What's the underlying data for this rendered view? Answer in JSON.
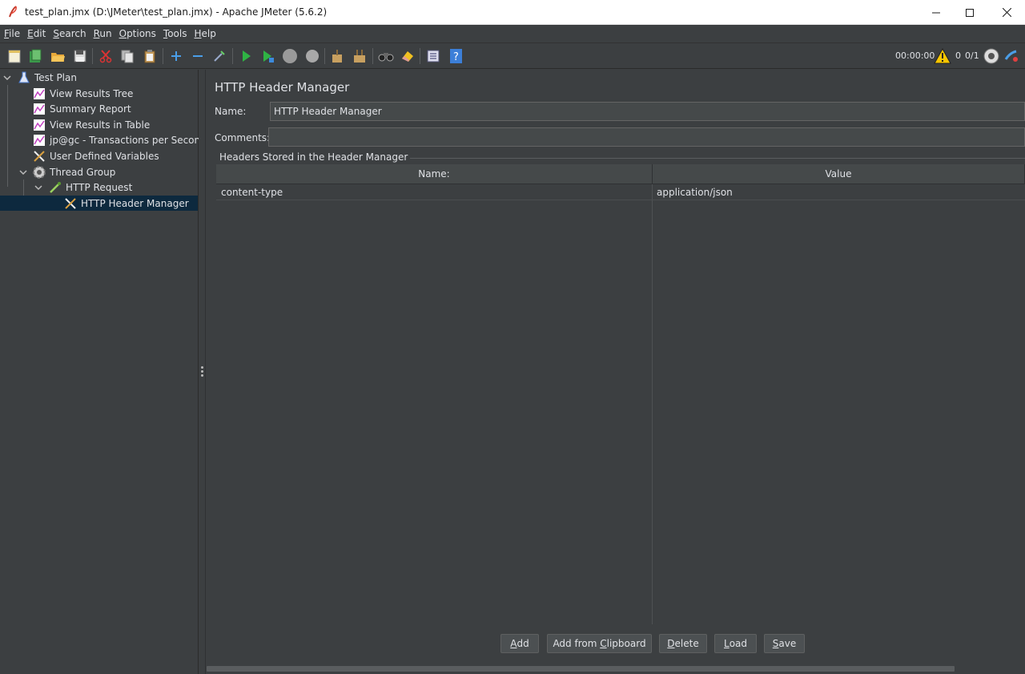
{
  "window": {
    "title": "test_plan.jmx (D:\\JMeter\\test_plan.jmx) - Apache JMeter (5.6.2)"
  },
  "menu": [
    {
      "mnemonic": "F",
      "rest": "ile"
    },
    {
      "mnemonic": "E",
      "rest": "dit"
    },
    {
      "mnemonic": "S",
      "rest": "earch"
    },
    {
      "mnemonic": "R",
      "rest": "un"
    },
    {
      "mnemonic": "O",
      "rest": "ptions"
    },
    {
      "mnemonic": "T",
      "rest": "ools"
    },
    {
      "mnemonic": "H",
      "rest": "elp"
    }
  ],
  "toolbar": {
    "elapsed_time": "00:00:00",
    "warning_count": "0",
    "active_threads": "0/1"
  },
  "tree": [
    {
      "label": "Test Plan",
      "icon": "flask-icon"
    },
    {
      "label": "View Results Tree",
      "icon": "graph-icon"
    },
    {
      "label": "Summary Report",
      "icon": "graph-icon"
    },
    {
      "label": "View Results in Table",
      "icon": "graph-icon"
    },
    {
      "label": "jp@gc - Transactions per Second",
      "icon": "graph-icon"
    },
    {
      "label": "User Defined Variables",
      "icon": "wrench-icon"
    },
    {
      "label": "Thread Group",
      "icon": "gear-icon"
    },
    {
      "label": "HTTP Request",
      "icon": "pipette-icon"
    },
    {
      "label": "HTTP Header Manager",
      "icon": "wrench-icon"
    }
  ],
  "panel": {
    "title": "HTTP Header Manager",
    "name_label": "Name:",
    "name_value": "HTTP Header Manager",
    "comments_label": "Comments:",
    "comments_value": "",
    "group_title": "Headers Stored in the Header Manager",
    "columns": [
      "Name:",
      "Value"
    ],
    "rows": [
      {
        "name": "content-type",
        "value": "application/json"
      }
    ]
  },
  "buttons": [
    {
      "mnemonic": "A",
      "rest": "dd",
      "pre": ""
    },
    {
      "pre": "Add from ",
      "mnemonic": "C",
      "rest": "lipboard"
    },
    {
      "mnemonic": "D",
      "rest": "elete",
      "pre": ""
    },
    {
      "mnemonic": "L",
      "rest": "oad",
      "pre": ""
    },
    {
      "mnemonic": "S",
      "rest": "ave",
      "pre": ""
    }
  ]
}
